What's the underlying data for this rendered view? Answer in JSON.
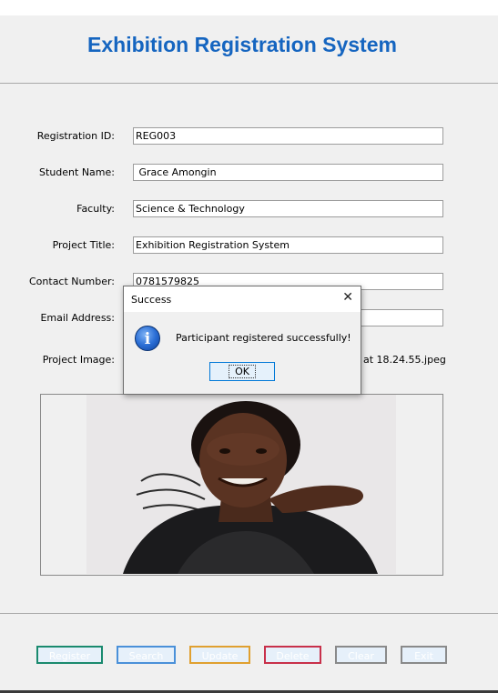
{
  "app": {
    "title": "Exhibition Registration System"
  },
  "form": {
    "fields": [
      {
        "label": "Registration ID:",
        "value": "REG003"
      },
      {
        "label": "Student Name:",
        "value": " Grace Amongin"
      },
      {
        "label": "Faculty:",
        "value": "Science & Technology"
      },
      {
        "label": "Project Title:",
        "value": "Exhibition Registration System"
      },
      {
        "label": "Contact Number:",
        "value": "0781579825"
      },
      {
        "label": "Email Address:",
        "value": ""
      }
    ],
    "image_label": "Project Image:",
    "image_path_visible": "at 18.24.55.jpeg"
  },
  "buttons": {
    "register": "Register",
    "search": "Search",
    "update": "Update",
    "delete": "Delete",
    "clear": "Clear",
    "exit": "Exit"
  },
  "button_colors": {
    "register": "#1a8a6e",
    "search": "#4a90d9",
    "update": "#e0a030",
    "delete": "#c8304a",
    "clear": "#8a8a8a",
    "exit": "#8a8a8a"
  },
  "dialog": {
    "title": "Success",
    "close_glyph": "✕",
    "icon_glyph": "i",
    "message": "Participant registered successfully!",
    "ok_label": "OK"
  }
}
